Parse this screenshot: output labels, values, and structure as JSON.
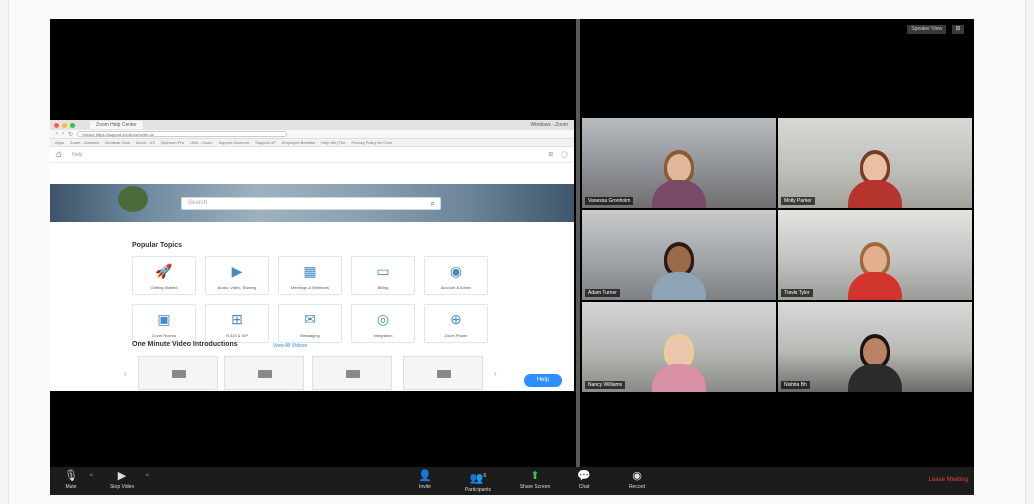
{
  "colors": {
    "accent": "#2d8cff",
    "leave": "#e0463a",
    "active_speaker": "#9acd32"
  },
  "browser": {
    "tab_title": "Zoom Help Center",
    "tab_right": "Windows - Zoom",
    "address": "Secure  https://support.zoom.us/hc/en-us",
    "bookmarks": [
      "Apps",
      "Zoom - Dotdash",
      "Zendesk Chat",
      "Zoom - US",
      "MyZoom Pro",
      "UWL - Zoom",
      "Support Zoom.us",
      "Support UP",
      "Employee Benefits",
      "Help Me (The",
      "Privacy Policy for Chat"
    ],
    "nav_label": "Help"
  },
  "help_site": {
    "search_placeholder": "Search",
    "popular_title": "Popular Topics",
    "topics": [
      {
        "label": "Getting Started",
        "icon": "rocket-icon",
        "glyph": "🚀"
      },
      {
        "label": "Audio, Video, Sharing",
        "icon": "video-icon",
        "glyph": "▶"
      },
      {
        "label": "Meetings & Webinars",
        "icon": "calendar-icon",
        "glyph": "▦"
      },
      {
        "label": "Billing",
        "icon": "card-icon",
        "glyph": "▭"
      },
      {
        "label": "Account & Admin",
        "icon": "user-icon",
        "glyph": "◉"
      },
      {
        "label": "Zoom Rooms",
        "icon": "room-icon",
        "glyph": "▣"
      },
      {
        "label": "H.323 & SIP",
        "icon": "network-icon",
        "glyph": "⊞"
      },
      {
        "label": "Messaging",
        "icon": "chat-icon",
        "glyph": "✉"
      },
      {
        "label": "Integration",
        "icon": "integration-icon",
        "glyph": "◎"
      },
      {
        "label": "Zoom Phone",
        "icon": "globe-icon",
        "glyph": "⊕"
      }
    ],
    "videos_title": "One Minute Video Introductions",
    "videos_link": "View All Videos",
    "help_button": "Help"
  },
  "gallery": {
    "speaker_view_label": "Speaker View",
    "participants": [
      {
        "name": "Vanessa Gronholm",
        "active": true
      },
      {
        "name": "Molly Parker",
        "active": false
      },
      {
        "name": "Adam Turner",
        "active": false
      },
      {
        "name": "Travis Tyler",
        "active": false
      },
      {
        "name": "Nancy Williams",
        "active": false
      },
      {
        "name": "Nishita Bh",
        "active": false
      }
    ]
  },
  "toolbar": {
    "mute": "Mute",
    "stop_video": "Stop Video",
    "invite": "Invite",
    "participants": "Participants",
    "participants_count": "6",
    "share_screen": "Share Screen",
    "chat": "Chat",
    "record": "Record",
    "leave": "Leave Meeting"
  }
}
